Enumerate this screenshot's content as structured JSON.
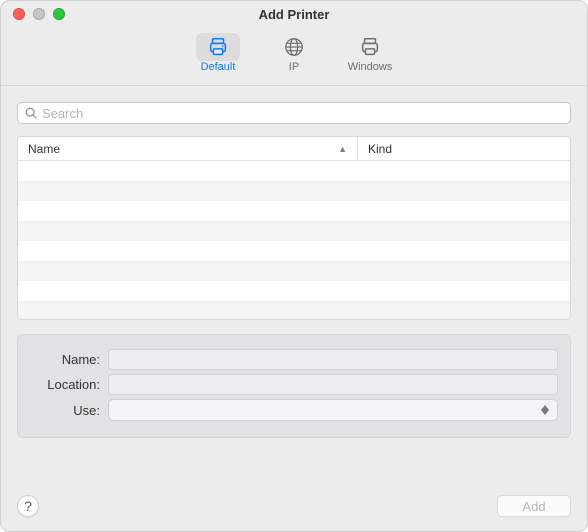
{
  "window": {
    "title": "Add Printer"
  },
  "toolbar": {
    "items": [
      {
        "id": "default",
        "label": "Default",
        "selected": true
      },
      {
        "id": "ip",
        "label": "IP",
        "selected": false
      },
      {
        "id": "windows",
        "label": "Windows",
        "selected": false
      }
    ]
  },
  "search": {
    "placeholder": "Search",
    "value": ""
  },
  "table": {
    "columns": [
      {
        "id": "name",
        "label": "Name",
        "sort": "asc"
      },
      {
        "id": "kind",
        "label": "Kind"
      }
    ],
    "rows": []
  },
  "form": {
    "name": {
      "label": "Name:",
      "value": ""
    },
    "location": {
      "label": "Location:",
      "value": ""
    },
    "use": {
      "label": "Use:",
      "value": "",
      "options": []
    }
  },
  "footer": {
    "help_tooltip": "?",
    "add_label": "Add",
    "add_enabled": false
  },
  "colors": {
    "accent": "#0a78ff",
    "window_bg": "#ececec",
    "panel_bg": "#e2e2e4"
  }
}
